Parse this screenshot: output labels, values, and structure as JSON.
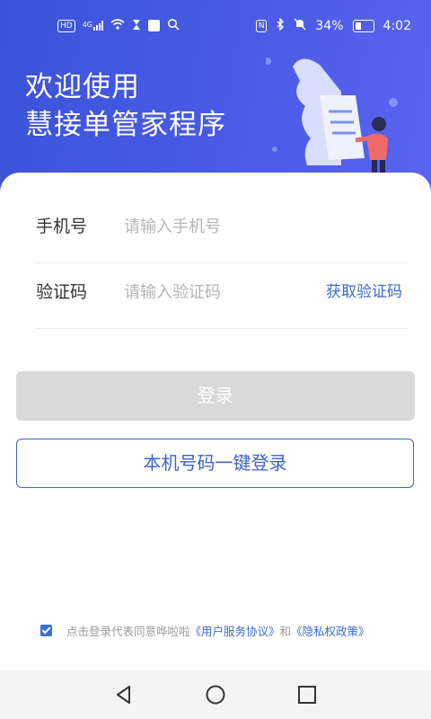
{
  "status_bar": {
    "hd": "HD",
    "network": "4G",
    "bluetooth_nfc": "N",
    "battery": "34%",
    "time": "4:02"
  },
  "hero": {
    "line1": "欢迎使用",
    "line2": "慧接单管家程序"
  },
  "form": {
    "phone_label": "手机号",
    "phone_placeholder": "请输入手机号",
    "code_label": "验证码",
    "code_placeholder": "请输入验证码",
    "get_code": "获取验证码"
  },
  "buttons": {
    "login": "登录",
    "one_key_login": "本机号码一键登录"
  },
  "agreement": {
    "prefix": "点击登录代表同意哗啦啦",
    "user_agreement": "《用户服务协议》",
    "and": "和",
    "privacy_policy": "《隐私权政策》",
    "checked": true
  },
  "colors": {
    "hero_bg": "#3f56dd",
    "accent": "#3a6bd0",
    "disabled_button": "#d9d9d9"
  }
}
